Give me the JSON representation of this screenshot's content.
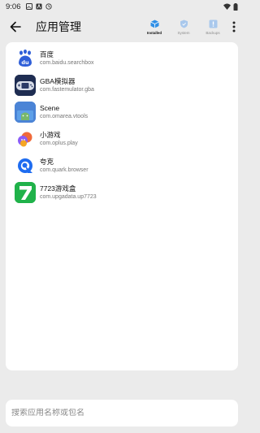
{
  "status_bar": {
    "time": "9:06"
  },
  "header": {
    "title": "应用管理",
    "tabs": [
      {
        "label": "Installed",
        "icon": "box-icon",
        "active": true
      },
      {
        "label": "System",
        "icon": "shield-icon",
        "active": false
      },
      {
        "label": "Backups",
        "icon": "archive-icon",
        "active": false
      }
    ]
  },
  "apps": [
    {
      "name": "百度",
      "package": "com.baidu.searchbox",
      "icon": "baidu-icon"
    },
    {
      "name": "GBA模拟器",
      "package": "com.fastemulator.gba",
      "icon": "gba-icon"
    },
    {
      "name": "Scene",
      "package": "com.omarea.vtools",
      "icon": "scene-icon"
    },
    {
      "name": "小游戏",
      "package": "com.oplus.play",
      "icon": "minigame-icon"
    },
    {
      "name": "夸克",
      "package": "com.quark.browser",
      "icon": "quark-icon"
    },
    {
      "name": "7723游戏盒",
      "package": "com.upgadata.up7723",
      "icon": "7723-icon"
    }
  ],
  "search": {
    "placeholder": "搜索应用名称或包名",
    "value": ""
  },
  "colors": {
    "accent": "#2f8fe6",
    "background": "#ebebeb",
    "card": "#ffffff"
  }
}
